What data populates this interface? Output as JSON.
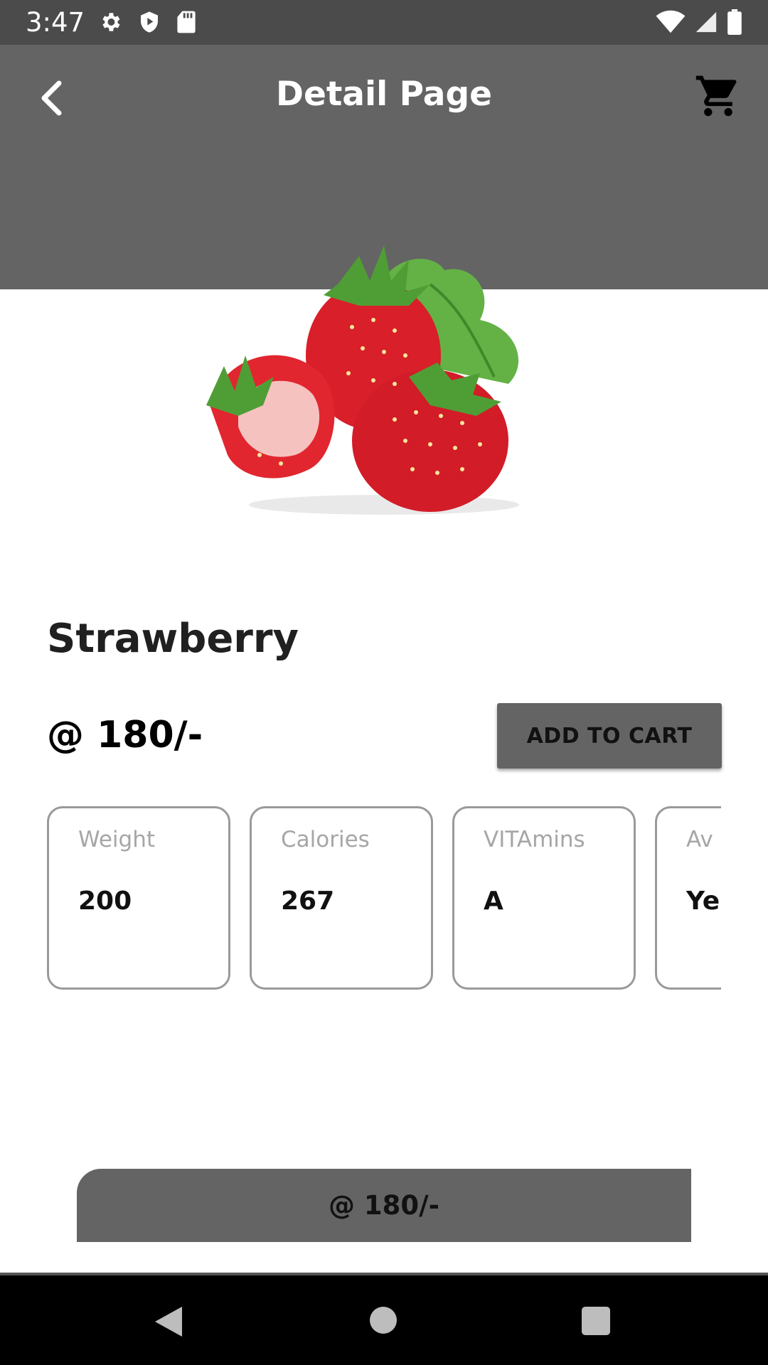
{
  "status_bar": {
    "time": "3:47",
    "icons": [
      "gear-icon",
      "shield-play-icon",
      "sd-card-icon",
      "wifi-icon",
      "signal-icon",
      "battery-icon"
    ]
  },
  "app_bar": {
    "title": "Detail Page",
    "back_icon": "chevron-left-icon",
    "cart_icon": "shopping-cart-icon",
    "background": "#646464"
  },
  "product": {
    "name": "Strawberry",
    "price": "@ 180/-",
    "add_to_cart_label": "ADD TO CART",
    "image": "strawberries"
  },
  "attributes": [
    {
      "label": "Weight",
      "value": "200"
    },
    {
      "label": "Calories",
      "value": "267"
    },
    {
      "label": "VITAmins",
      "value": "A"
    },
    {
      "label": "Av",
      "value": "Ye"
    }
  ],
  "bottom_bar": {
    "price": "@ 180/-"
  },
  "colors": {
    "accent": "#646464",
    "status_bar": "#4b4b4b",
    "chip_border": "#9a9a9a",
    "strawberry_red": "#d81f2a",
    "leaf_green": "#5aa83a"
  }
}
